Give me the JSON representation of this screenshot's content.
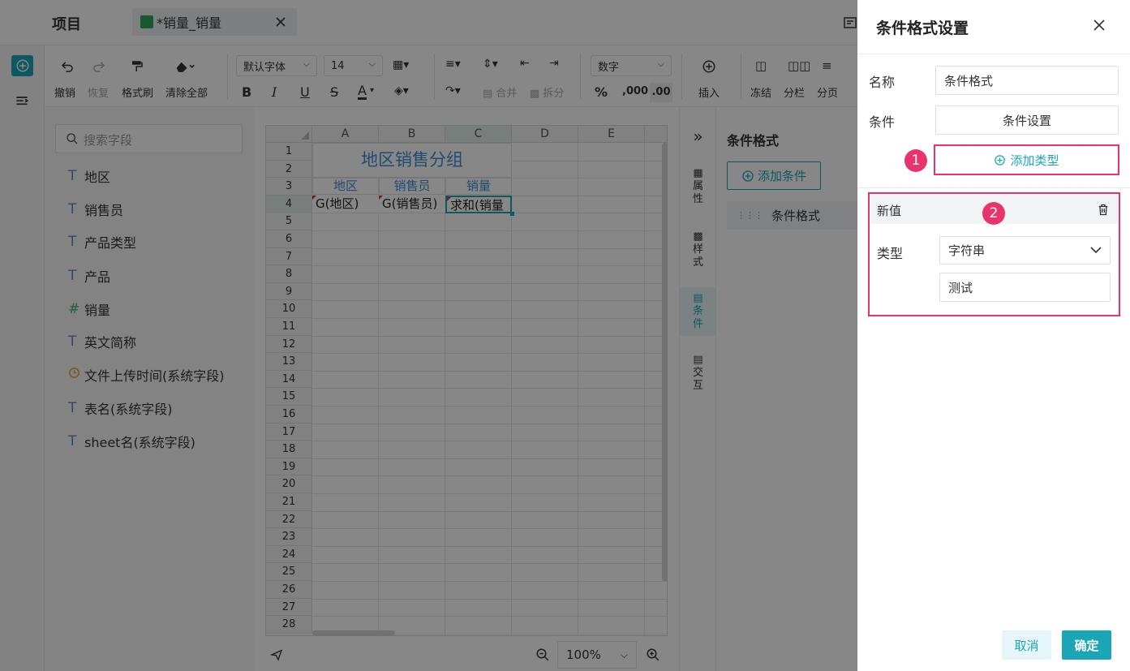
{
  "topbar": {
    "project_label": "项目",
    "tab_title": "*销量_销量"
  },
  "toolbar": {
    "undo": "撤销",
    "redo": "恢复",
    "format_painter": "格式刷",
    "clear_all": "清除全部",
    "font_family": "默认字体",
    "font_size": "14",
    "merge": "合并",
    "split": "拆分",
    "number_format": "数字",
    "percent": "%",
    "thousands": ",000",
    "decimal": ".00",
    "insert": "插入",
    "freeze": "冻结",
    "columns": "分栏",
    "paging": "分页"
  },
  "fields": {
    "search_placeholder": "搜索字段",
    "items": [
      {
        "icon": "T",
        "label": "地区"
      },
      {
        "icon": "T",
        "label": "销售员"
      },
      {
        "icon": "T",
        "label": "产品类型"
      },
      {
        "icon": "T",
        "label": "产品"
      },
      {
        "icon": "#",
        "label": "销量"
      },
      {
        "icon": "T",
        "label": "英文简称"
      },
      {
        "icon": "clock",
        "label": "文件上传时间(系统字段)"
      },
      {
        "icon": "T",
        "label": "表名(系统字段)"
      },
      {
        "icon": "T",
        "label": "sheet名(系统字段)"
      }
    ]
  },
  "sheet": {
    "columns": [
      "A",
      "B",
      "C",
      "D",
      "E"
    ],
    "rows": [
      "1",
      "2",
      "3",
      "4",
      "5",
      "6",
      "7",
      "8",
      "9",
      "10",
      "11",
      "12",
      "13",
      "14",
      "15",
      "16",
      "17",
      "18",
      "19",
      "20",
      "21",
      "22",
      "23",
      "24",
      "25",
      "26",
      "27",
      "28"
    ],
    "title": "地区销售分组",
    "headers": [
      "地区",
      "销售员",
      "销量"
    ],
    "cells": [
      "G(地区)",
      "G(销售员)",
      "求和(销量"
    ],
    "zoom": "100%"
  },
  "sidetabs": {
    "collapse": "»",
    "props": "属\n性",
    "style": "样\n式",
    "cond": "条\n件",
    "interact": "交\n互"
  },
  "condpanel": {
    "title": "条件格式",
    "add_btn": "添加条件",
    "item": "条件格式"
  },
  "drawer": {
    "title": "条件格式设置",
    "name_label": "名称",
    "name_value": "条件格式",
    "cond_label": "条件",
    "cond_btn": "条件设置",
    "add_type": "添加类型",
    "badge1": "1",
    "badge2": "2",
    "new_value": "新值",
    "type_label": "类型",
    "type_value": "字符串",
    "text_value": "测试",
    "cancel": "取消",
    "confirm": "确定"
  },
  "colors": {
    "accent": "#1aa6b7",
    "highlight": "#e8336d",
    "title_blue": "#3d8fd6"
  }
}
